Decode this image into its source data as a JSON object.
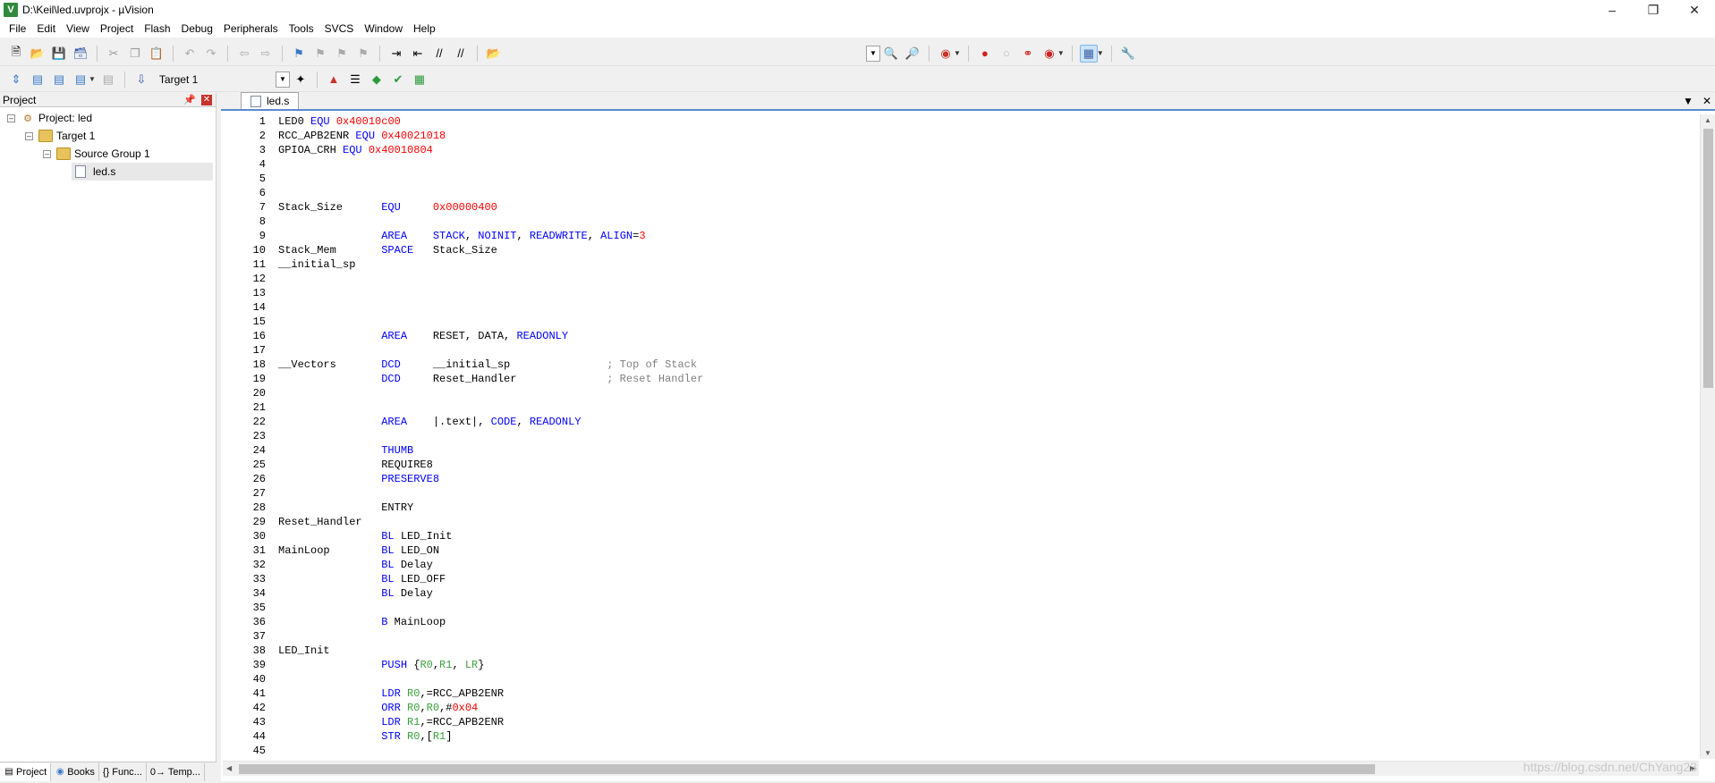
{
  "window": {
    "title": "D:\\Keil\\led.uvprojx - µVision",
    "controls": [
      "minimize",
      "restore",
      "close"
    ]
  },
  "menu": [
    "File",
    "Edit",
    "View",
    "Project",
    "Flash",
    "Debug",
    "Peripherals",
    "Tools",
    "SVCS",
    "Window",
    "Help"
  ],
  "toolbar2": {
    "target": "Target 1"
  },
  "project_panel": {
    "header": "Project",
    "tree": {
      "project": "Project: led",
      "target": "Target 1",
      "group": "Source Group 1",
      "file": "led.s"
    },
    "tabs": [
      "Project",
      "Books",
      "{} Func...",
      "0→ Temp..."
    ]
  },
  "editor": {
    "tab_label": "led.s",
    "lines": [
      {
        "n": "1",
        "parts": [
          [
            "LED0 ",
            ""
          ],
          [
            "EQU",
            "kw"
          ],
          [
            " ",
            ""
          ],
          [
            "0x40010c00",
            "num"
          ]
        ]
      },
      {
        "n": "2",
        "parts": [
          [
            "RCC_APB2ENR ",
            ""
          ],
          [
            "EQU",
            "kw"
          ],
          [
            " ",
            ""
          ],
          [
            "0x40021018",
            "num"
          ]
        ]
      },
      {
        "n": "3",
        "parts": [
          [
            "GPIOA_CRH ",
            ""
          ],
          [
            "EQU",
            "kw"
          ],
          [
            " ",
            ""
          ],
          [
            "0x40010804",
            "num"
          ]
        ]
      },
      {
        "n": "4",
        "parts": []
      },
      {
        "n": "5",
        "parts": []
      },
      {
        "n": "6",
        "parts": []
      },
      {
        "n": "7",
        "parts": [
          [
            "Stack_Size      ",
            ""
          ],
          [
            "EQU",
            "kw"
          ],
          [
            "     ",
            ""
          ],
          [
            "0x00000400",
            "num"
          ]
        ]
      },
      {
        "n": "8",
        "parts": []
      },
      {
        "n": "9",
        "parts": [
          [
            "                ",
            ""
          ],
          [
            "AREA",
            "kw"
          ],
          [
            "    ",
            ""
          ],
          [
            "STACK",
            "kw"
          ],
          [
            ", ",
            ""
          ],
          [
            "NOINIT",
            "kw"
          ],
          [
            ", ",
            ""
          ],
          [
            "READWRITE",
            "kw"
          ],
          [
            ", ",
            ""
          ],
          [
            "ALIGN",
            "kw"
          ],
          [
            "=",
            ""
          ],
          [
            "3",
            "num"
          ]
        ]
      },
      {
        "n": "10",
        "parts": [
          [
            "Stack_Mem       ",
            ""
          ],
          [
            "SPACE",
            "kw"
          ],
          [
            "   Stack_Size",
            ""
          ]
        ]
      },
      {
        "n": "11",
        "parts": [
          [
            "__initial_sp",
            ""
          ]
        ]
      },
      {
        "n": "12",
        "parts": []
      },
      {
        "n": "13",
        "parts": []
      },
      {
        "n": "14",
        "parts": []
      },
      {
        "n": "15",
        "parts": []
      },
      {
        "n": "16",
        "parts": [
          [
            "                ",
            ""
          ],
          [
            "AREA",
            "kw"
          ],
          [
            "    RESET, DATA, ",
            ""
          ],
          [
            "READONLY",
            "kw"
          ]
        ]
      },
      {
        "n": "17",
        "parts": []
      },
      {
        "n": "18",
        "parts": [
          [
            "__Vectors       ",
            ""
          ],
          [
            "DCD",
            "kw"
          ],
          [
            "     __initial_sp               ",
            ""
          ],
          [
            "; Top of Stack",
            "cmt"
          ]
        ]
      },
      {
        "n": "19",
        "parts": [
          [
            "                ",
            ""
          ],
          [
            "DCD",
            "kw"
          ],
          [
            "     Reset_Handler              ",
            ""
          ],
          [
            "; Reset Handler",
            "cmt"
          ]
        ]
      },
      {
        "n": "20",
        "parts": []
      },
      {
        "n": "21",
        "parts": []
      },
      {
        "n": "22",
        "parts": [
          [
            "                ",
            ""
          ],
          [
            "AREA",
            "kw"
          ],
          [
            "    |.text|, ",
            ""
          ],
          [
            "CODE",
            "kw"
          ],
          [
            ", ",
            ""
          ],
          [
            "READONLY",
            "kw"
          ]
        ]
      },
      {
        "n": "23",
        "parts": []
      },
      {
        "n": "24",
        "parts": [
          [
            "                ",
            ""
          ],
          [
            "THUMB",
            "kw"
          ]
        ]
      },
      {
        "n": "25",
        "parts": [
          [
            "                REQUIRE8",
            ""
          ]
        ]
      },
      {
        "n": "26",
        "parts": [
          [
            "                ",
            ""
          ],
          [
            "PRESERVE8",
            "kw"
          ]
        ]
      },
      {
        "n": "27",
        "parts": []
      },
      {
        "n": "28",
        "parts": [
          [
            "                ENTRY",
            ""
          ]
        ]
      },
      {
        "n": "29",
        "parts": [
          [
            "Reset_Handler",
            ""
          ]
        ]
      },
      {
        "n": "30",
        "parts": [
          [
            "                ",
            ""
          ],
          [
            "BL",
            "kw"
          ],
          [
            " LED_Init",
            ""
          ]
        ]
      },
      {
        "n": "31",
        "parts": [
          [
            "MainLoop        ",
            ""
          ],
          [
            "BL",
            "kw"
          ],
          [
            " LED_ON",
            ""
          ]
        ]
      },
      {
        "n": "32",
        "parts": [
          [
            "                ",
            ""
          ],
          [
            "BL",
            "kw"
          ],
          [
            " Delay",
            ""
          ]
        ]
      },
      {
        "n": "33",
        "parts": [
          [
            "                ",
            ""
          ],
          [
            "BL",
            "kw"
          ],
          [
            " LED_OFF",
            ""
          ]
        ]
      },
      {
        "n": "34",
        "parts": [
          [
            "                ",
            ""
          ],
          [
            "BL",
            "kw"
          ],
          [
            " Delay",
            ""
          ]
        ]
      },
      {
        "n": "35",
        "parts": []
      },
      {
        "n": "36",
        "parts": [
          [
            "                ",
            ""
          ],
          [
            "B",
            "kw"
          ],
          [
            " MainLoop",
            ""
          ]
        ]
      },
      {
        "n": "37",
        "parts": []
      },
      {
        "n": "38",
        "parts": [
          [
            "LED_Init",
            ""
          ]
        ]
      },
      {
        "n": "39",
        "parts": [
          [
            "                ",
            ""
          ],
          [
            "PUSH",
            "kw"
          ],
          [
            " {",
            ""
          ],
          [
            "R0",
            "reg"
          ],
          [
            ",",
            ""
          ],
          [
            "R1",
            "reg"
          ],
          [
            ", ",
            ""
          ],
          [
            "LR",
            "reg"
          ],
          [
            "}",
            ""
          ]
        ]
      },
      {
        "n": "40",
        "parts": []
      },
      {
        "n": "41",
        "parts": [
          [
            "                ",
            ""
          ],
          [
            "LDR",
            "kw"
          ],
          [
            " ",
            ""
          ],
          [
            "R0",
            "reg"
          ],
          [
            ",=RCC_APB2ENR",
            ""
          ]
        ]
      },
      {
        "n": "42",
        "parts": [
          [
            "                ",
            ""
          ],
          [
            "ORR",
            "kw"
          ],
          [
            " ",
            ""
          ],
          [
            "R0",
            "reg"
          ],
          [
            ",",
            ""
          ],
          [
            "R0",
            "reg"
          ],
          [
            ",#",
            ""
          ],
          [
            "0x04",
            "num"
          ]
        ]
      },
      {
        "n": "43",
        "parts": [
          [
            "                ",
            ""
          ],
          [
            "LDR",
            "kw"
          ],
          [
            " ",
            ""
          ],
          [
            "R1",
            "reg"
          ],
          [
            ",=RCC_APB2ENR",
            ""
          ]
        ]
      },
      {
        "n": "44",
        "parts": [
          [
            "                ",
            ""
          ],
          [
            "STR",
            "kw"
          ],
          [
            " ",
            ""
          ],
          [
            "R0",
            "reg"
          ],
          [
            ",[",
            ""
          ],
          [
            "R1",
            "reg"
          ],
          [
            "]",
            ""
          ]
        ]
      },
      {
        "n": "45",
        "parts": []
      }
    ]
  },
  "watermark": "https://blog.csdn.net/ChYang23"
}
